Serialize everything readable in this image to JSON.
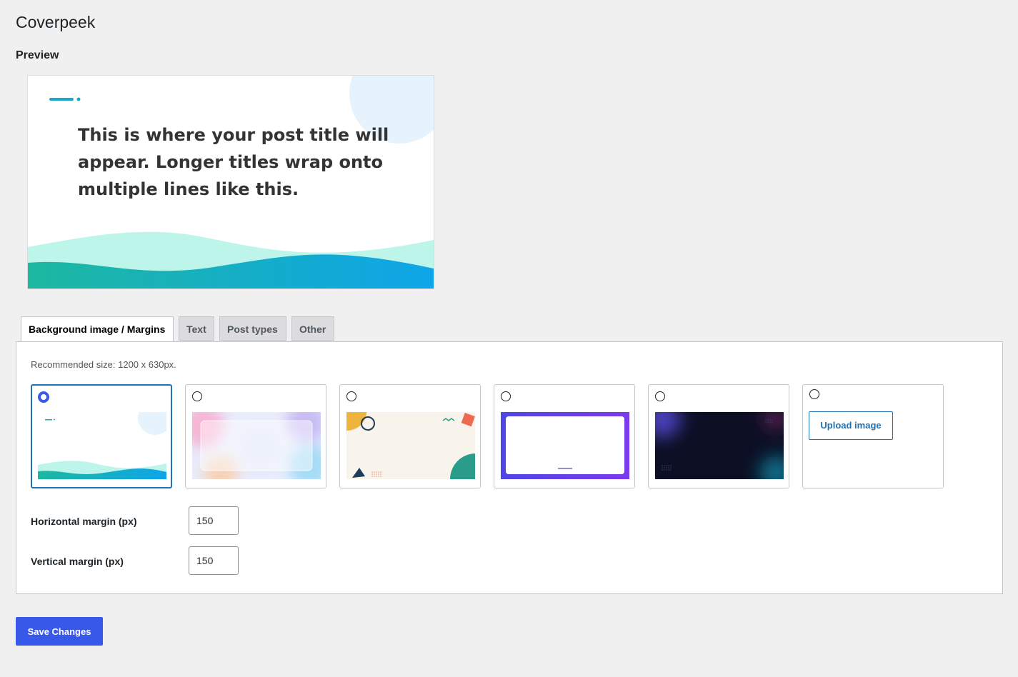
{
  "page": {
    "title": "Coverpeek"
  },
  "preview": {
    "heading": "Preview",
    "title_text": "This is where your post title will appear. Longer titles wrap onto multiple lines like this."
  },
  "tabs": [
    {
      "label": "Background image / Margins",
      "active": true
    },
    {
      "label": "Text",
      "active": false
    },
    {
      "label": "Post types",
      "active": false
    },
    {
      "label": "Other",
      "active": false
    }
  ],
  "background": {
    "hint": "Recommended size: 1200 x 630px.",
    "options": [
      {
        "name": "waves",
        "selected": true
      },
      {
        "name": "pastel-glass",
        "selected": false
      },
      {
        "name": "memphis-shapes",
        "selected": false
      },
      {
        "name": "purple-frame",
        "selected": false
      },
      {
        "name": "dark-glow",
        "selected": false
      },
      {
        "name": "upload",
        "selected": false
      }
    ],
    "upload_label": "Upload image"
  },
  "margins": {
    "horizontal_label": "Horizontal margin (px)",
    "horizontal_value": "150",
    "vertical_label": "Vertical margin (px)",
    "vertical_value": "150"
  },
  "actions": {
    "save_label": "Save Changes"
  },
  "colors": {
    "accent": "#3858e9",
    "link": "#2271b1",
    "background": "#f0f0f1"
  }
}
